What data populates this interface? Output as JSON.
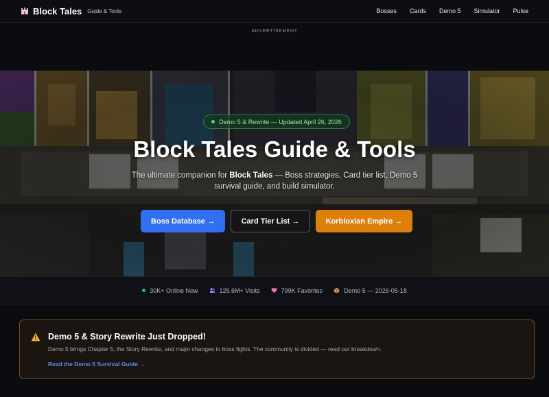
{
  "nav": {
    "brand": "Block Tales",
    "brand_sub": "Guide & Tools",
    "links": [
      "Bosses",
      "Cards",
      "Demo 5",
      "Simulator",
      "Pulse"
    ]
  },
  "ad": {
    "label": "ADVERTISEMENT"
  },
  "hero": {
    "badge": "Demo 5 & Rewrite — Updated April 26, 2026",
    "title": "Block Tales Guide & Tools",
    "desc_pre": "The ultimate companion for ",
    "desc_bold": "Block Tales",
    "desc_post": " — Boss strategies, Card tier list, Demo 5 survival guide, and build simulator.",
    "buttons": {
      "boss": "Boss Database →",
      "cards": "Card Tier List →",
      "empire": "Korbloxian Empire →"
    }
  },
  "stats": {
    "online": "30K+ Online Now",
    "visits": "125.6M+ Visits",
    "favorites": "799K Favorites",
    "demo": "Demo 5 — 2026-05-18"
  },
  "alert": {
    "title": "Demo 5 & Story Rewrite Just Dropped!",
    "text": "Demo 5 brings Chapter 5, the Story Rewrite, and major changes to boss fights. The community is divided — read our breakdown.",
    "link": "Read the Demo 5 Survival Guide →"
  },
  "colors": {
    "accent_blue": "#2f6ff0",
    "accent_orange": "#dd7f0b",
    "badge_green": "#4ade80",
    "alert_border": "#7a4d12",
    "link_blue": "#5b8df6"
  }
}
